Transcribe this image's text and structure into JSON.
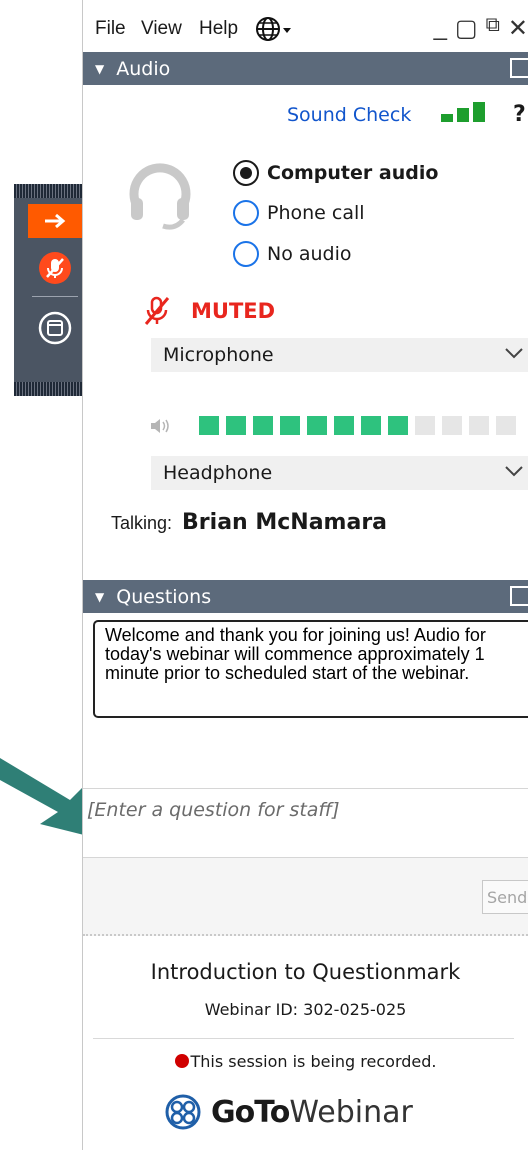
{
  "menubar": {
    "file": "File",
    "view": "View",
    "help": "Help"
  },
  "window_controls": {
    "minimize": "_",
    "maximize": "▢",
    "popout": "⧉",
    "close": "✕"
  },
  "audio": {
    "header": "Audio",
    "sound_check": "Sound Check",
    "help": "?",
    "options": [
      {
        "label": "Computer audio",
        "selected": true
      },
      {
        "label": "Phone call",
        "selected": false
      },
      {
        "label": "No audio",
        "selected": false
      }
    ],
    "muted_label": "MUTED",
    "microphone": "Microphone",
    "headphone": "Headphone",
    "level_segments_active": 8,
    "level_segments_total": 12,
    "talking_label": "Talking:",
    "talking_name": "Brian McNamara"
  },
  "questions": {
    "header": "Questions",
    "welcome": "Welcome and thank you for joining us! Audio for today's webinar will commence approximately 1 minute prior to scheduled start of the webinar.",
    "placeholder": "[Enter a question for staff]",
    "send": "Send"
  },
  "footer": {
    "title": "Introduction to Questionmark",
    "webinar_id": "Webinar ID: 302-025-025",
    "recording": "This session is being recorded.",
    "brand_goto": "GoTo",
    "brand_webinar": "Webinar"
  },
  "colors": {
    "accent_orange": "#ff5a00",
    "header": "#5c6a7b",
    "muted_red": "#e8261e",
    "meter_green": "#2ec27e",
    "link_blue": "#1155cc",
    "arrow_teal": "#2f7f76"
  }
}
